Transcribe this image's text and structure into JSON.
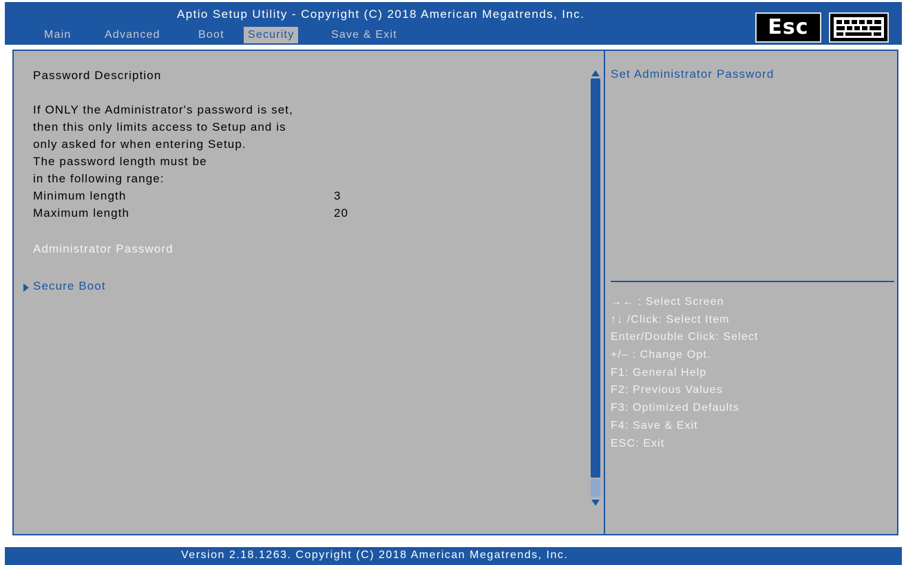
{
  "header": {
    "title": "Aptio Setup Utility - Copyright (C) 2018 American Megatrends, Inc.",
    "tabs": [
      {
        "label": "Main",
        "active": false
      },
      {
        "label": "Advanced",
        "active": false
      },
      {
        "label": "Boot",
        "active": false
      },
      {
        "label": "Security",
        "active": true
      },
      {
        "label": "Save & Exit",
        "active": false
      }
    ],
    "esc_label": "Esc",
    "keyboard_icon": "keyboard-icon"
  },
  "main": {
    "section_title": "Password Description",
    "description_lines": [
      "If ONLY the Administrator's password is set,",
      "then this only limits access to Setup and is",
      "only asked for when entering Setup.",
      "The password length must be",
      "in the following range:"
    ],
    "min_length_label": "Minimum length",
    "min_length_value": "3",
    "max_length_label": "Maximum length",
    "max_length_value": "20",
    "admin_password_item": "Administrator Password",
    "secure_boot_item": "Secure Boot"
  },
  "help": {
    "title": "Set Administrator Password",
    "keys": [
      "→← : Select Screen",
      "↑↓ /Click: Select Item",
      "Enter/Double Click: Select",
      "+/– : Change Opt.",
      "F1: General Help",
      "F2: Previous Values",
      "F3: Optimized Defaults",
      "F4: Save & Exit",
      "ESC: Exit"
    ]
  },
  "footer": {
    "version": "Version 2.18.1263. Copyright (C) 2018 American Megatrends, Inc."
  },
  "colors": {
    "accent": "#1d56a2",
    "panel_bg": "#b4b4b4",
    "highlight_text": "#f4f4f4"
  }
}
